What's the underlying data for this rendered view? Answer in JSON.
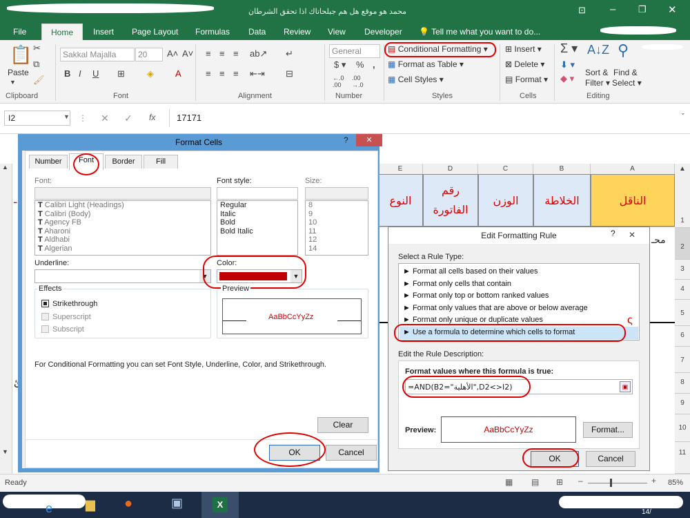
{
  "window": {
    "title": "محمد هو موقع هل هم جبلحاتاك اذا تحقق الشرطان"
  },
  "tabs": [
    "File",
    "Home",
    "Insert",
    "Page Layout",
    "Formulas",
    "Data",
    "Review",
    "View",
    "Developer",
    "Tell me what you want to do..."
  ],
  "ribbon": {
    "paste": "Paste",
    "clipboard": "Clipboard",
    "font_name": "Sakkal Majalla",
    "font_size": "20",
    "font_group": "Font",
    "alignment": "Alignment",
    "number_format": "General",
    "number_group": "Number",
    "cond_format": "Conditional Formatting",
    "format_table": "Format as Table",
    "cell_styles": "Cell Styles",
    "styles": "Styles",
    "insert": "Insert",
    "delete": "Delete",
    "format": "Format",
    "cells": "Cells",
    "sort1": "Sort &",
    "sort2": "Filter",
    "find1": "Find &",
    "find2": "Select",
    "editing": "Editing"
  },
  "formula_bar": {
    "name_box": "I2",
    "value": "17171",
    "fx": "fx"
  },
  "sheet": {
    "columns": [
      {
        "letter": "E",
        "header": "النوع"
      },
      {
        "letter": "D",
        "header": "رقم الفاتورة"
      },
      {
        "letter": "C",
        "header": "الوزن"
      },
      {
        "letter": "B",
        "header": "الخلاطة"
      },
      {
        "letter": "A",
        "header": "الناقل"
      }
    ],
    "rows": [
      "1",
      "2",
      "3",
      "4",
      "5",
      "6",
      "7",
      "8",
      "9",
      "10",
      "11"
    ],
    "a2": "محـ",
    "left_fragment": "ئ"
  },
  "format_cells": {
    "title": "Format Cells",
    "help": "?",
    "tabs": [
      "Number",
      "Font",
      "Border",
      "Fill"
    ],
    "font_label": "Font:",
    "style_label": "Font style:",
    "size_label": "Size:",
    "fonts": [
      "Calibri Light (Headings)",
      "Calibri (Body)",
      "Agency FB",
      "Aharoni",
      "Aldhabi",
      "Algerian"
    ],
    "styles": [
      "Regular",
      "Italic",
      "Bold",
      "Bold Italic"
    ],
    "sizes": [
      "8",
      "9",
      "10",
      "11",
      "12",
      "14"
    ],
    "underline_label": "Underline:",
    "color_label": "Color:",
    "effects_label": "Effects",
    "strike": "Strikethrough",
    "superscript": "Superscript",
    "subscript": "Subscript",
    "preview_label": "Preview",
    "preview_text": "AaBbCcYyZz",
    "note": "For Conditional Formatting you can set Font Style, Underline, Color, and Strikethrough.",
    "clear": "Clear",
    "ok": "OK",
    "cancel": "Cancel",
    "color_value": "#c00000"
  },
  "edit_rule": {
    "title": "Edit Formatting Rule",
    "help": "?",
    "select_label": "Select a Rule Type:",
    "rules": [
      "► Format all cells based on their values",
      "► Format only cells that contain",
      "► Format only top or bottom ranked values",
      "► Format only values that are above or below average",
      "► Format only unique or duplicate values",
      "► Use a formula to determine which cells to format"
    ],
    "edit_label": "Edit the Rule Description:",
    "formula_label": "Format values where this formula is true:",
    "formula": "=AND(B2=\"الأهلية\",D2<>I2)",
    "preview_label": "Preview:",
    "preview_text": "AaBbCcYyZz",
    "format_btn": "Format...",
    "ok": "OK",
    "cancel": "Cancel"
  },
  "status": {
    "ready": "Ready",
    "zoom": "85%"
  },
  "taskbar": {
    "clock": "14/"
  }
}
